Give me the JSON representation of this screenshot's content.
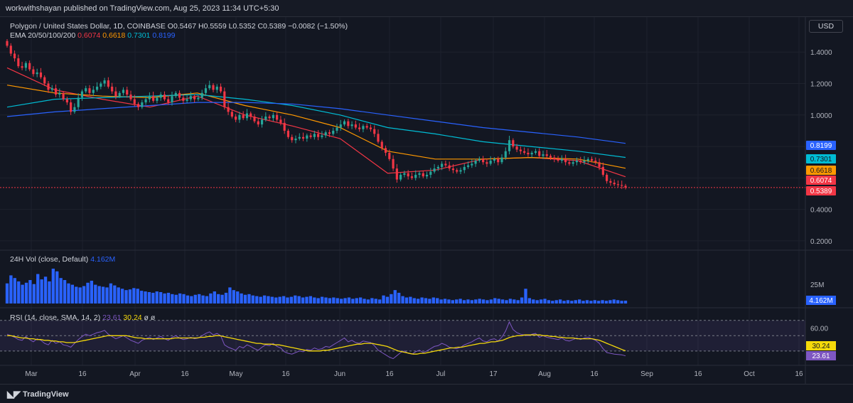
{
  "publish_line": "workwithshayan published on TradingView.com, Aug 25, 2023 11:34 UTC+5:30",
  "currency_button": "USD",
  "footer_logo_text": "TradingView",
  "legend": {
    "symbol": "Polygon / United States Dollar, 1D, COINBASE",
    "ohlc": "O0.5467 H0.5559 L0.5352 C0.5389 −0.0082 (−1.50%)",
    "ema_label": "EMA 20/50/100/200",
    "ema_values": [
      "0.6074",
      "0.6618",
      "0.7301",
      "0.8199"
    ]
  },
  "volume_legend": {
    "label": "24H Vol (close, Default)",
    "value": "4.162M"
  },
  "rsi_legend": {
    "label": "RSI (14, close, SMA, 14, 2)",
    "rsi": "23.61",
    "sma": "30.24",
    "extra": "ø ø"
  },
  "colors": {
    "background": "#131722",
    "grid": "#1e222d",
    "up": "#26a69a",
    "down": "#f23645",
    "ema20": "#f23645",
    "ema50": "#ff9800",
    "ema100": "#00bcd4",
    "ema200": "#2962ff",
    "volume": "#2962ff",
    "rsi": "#7e57c2",
    "rsi_sma": "#f5d90a"
  },
  "chart_data": {
    "type": "candlestick",
    "price_axis": {
      "ylim": [
        0.15,
        1.55
      ],
      "ticks": [
        "1.4000",
        "1.2000",
        "1.0000",
        "0.4000",
        "0.2000"
      ]
    },
    "time_axis": {
      "ticks": [
        "Mar",
        "16",
        "Apr",
        "16",
        "May",
        "16",
        "Jun",
        "16",
        "Jul",
        "17",
        "Aug",
        "16",
        "Sep",
        "16",
        "Oct",
        "16"
      ]
    },
    "price_labels": [
      {
        "value": 0.8199,
        "text": "0.8199",
        "color": "#2962ff"
      },
      {
        "value": 0.7301,
        "text": "0.7301",
        "color": "#00bcd4"
      },
      {
        "value": 0.6618,
        "text": "0.6618",
        "color": "#ff9800"
      },
      {
        "value": 0.6074,
        "text": "0.6074",
        "color": "#f23645"
      },
      {
        "value": 0.5389,
        "text": "0.5389",
        "color": "#f23645"
      }
    ],
    "last_close": 0.5389,
    "closes": [
      1.44,
      1.39,
      1.36,
      1.31,
      1.3,
      1.33,
      1.29,
      1.26,
      1.27,
      1.24,
      1.2,
      1.16,
      1.17,
      1.13,
      1.14,
      1.1,
      1.08,
      1.02,
      1.05,
      1.11,
      1.15,
      1.17,
      1.14,
      1.16,
      1.18,
      1.2,
      1.22,
      1.18,
      1.15,
      1.12,
      1.14,
      1.16,
      1.13,
      1.1,
      1.07,
      1.05,
      1.08,
      1.1,
      1.12,
      1.09,
      1.11,
      1.13,
      1.1,
      1.08,
      1.12,
      1.14,
      1.11,
      1.09,
      1.1,
      1.12,
      1.1,
      1.11,
      1.14,
      1.17,
      1.19,
      1.16,
      1.18,
      1.15,
      1.05,
      1.02,
      0.99,
      0.97,
      1.0,
      0.98,
      1.01,
      0.99,
      0.96,
      0.94,
      0.97,
      0.99,
      0.98,
      1.0,
      0.97,
      0.95,
      0.9,
      0.86,
      0.84,
      0.85,
      0.86,
      0.85,
      0.87,
      0.86,
      0.88,
      0.86,
      0.87,
      0.89,
      0.88,
      0.9,
      0.92,
      0.94,
      0.96,
      0.93,
      0.94,
      0.92,
      0.91,
      0.93,
      0.92,
      0.91,
      0.88,
      0.83,
      0.79,
      0.76,
      0.72,
      0.66,
      0.59,
      0.62,
      0.63,
      0.61,
      0.6,
      0.62,
      0.63,
      0.61,
      0.62,
      0.64,
      0.66,
      0.67,
      0.69,
      0.68,
      0.66,
      0.65,
      0.64,
      0.65,
      0.67,
      0.68,
      0.69,
      0.71,
      0.72,
      0.7,
      0.69,
      0.71,
      0.72,
      0.7,
      0.73,
      0.77,
      0.84,
      0.8,
      0.78,
      0.77,
      0.76,
      0.75,
      0.76,
      0.77,
      0.74,
      0.75,
      0.74,
      0.73,
      0.72,
      0.71,
      0.72,
      0.7,
      0.69,
      0.7,
      0.71,
      0.7,
      0.71,
      0.72,
      0.71,
      0.7,
      0.67,
      0.62,
      0.58,
      0.57,
      0.56,
      0.555,
      0.55,
      0.5389
    ],
    "ema": {
      "ema20": [
        1.3,
        1.16,
        1.1,
        1.05,
        1.12,
        1.0,
        0.93,
        0.85,
        0.63,
        0.65,
        0.72,
        0.73,
        0.71,
        0.6074
      ],
      "ema50": [
        1.19,
        1.14,
        1.12,
        1.11,
        1.14,
        1.06,
        1.0,
        0.92,
        0.77,
        0.72,
        0.72,
        0.73,
        0.72,
        0.6618
      ],
      "ema100": [
        1.05,
        1.1,
        1.11,
        1.12,
        1.13,
        1.1,
        1.06,
        1.0,
        0.92,
        0.88,
        0.83,
        0.8,
        0.77,
        0.7301
      ],
      "ema200": [
        0.99,
        1.02,
        1.04,
        1.06,
        1.08,
        1.08,
        1.07,
        1.04,
        1.0,
        0.96,
        0.92,
        0.89,
        0.86,
        0.8199
      ]
    },
    "volume": {
      "ticks": [
        "25M"
      ],
      "last": "4.162M",
      "values": [
        30,
        42,
        38,
        33,
        28,
        31,
        35,
        29,
        44,
        36,
        40,
        33,
        52,
        48,
        38,
        35,
        30,
        28,
        25,
        24,
        26,
        31,
        34,
        28,
        26,
        25,
        24,
        30,
        27,
        24,
        22,
        20,
        21,
        23,
        22,
        19,
        18,
        17,
        16,
        18,
        17,
        15,
        16,
        14,
        13,
        15,
        14,
        12,
        11,
        13,
        14,
        12,
        11,
        15,
        18,
        14,
        13,
        16,
        24,
        20,
        18,
        15,
        13,
        14,
        12,
        11,
        10,
        12,
        11,
        10,
        9,
        10,
        11,
        9,
        10,
        12,
        11,
        9,
        10,
        11,
        9,
        8,
        10,
        9,
        8,
        9,
        8,
        7,
        8,
        9,
        7,
        8,
        9,
        7,
        6,
        8,
        7,
        6,
        12,
        10,
        14,
        20,
        16,
        11,
        9,
        10,
        8,
        7,
        9,
        8,
        7,
        9,
        8,
        6,
        7,
        6,
        5,
        6,
        7,
        5,
        6,
        5,
        6,
        7,
        6,
        5,
        6,
        8,
        7,
        6,
        5,
        7,
        6,
        5,
        9,
        22,
        8,
        6,
        5,
        6,
        7,
        5,
        4,
        5,
        6,
        4,
        5,
        4,
        5,
        6,
        4,
        5,
        4,
        5,
        4,
        5,
        4,
        5,
        6,
        5,
        4,
        4.162
      ]
    },
    "rsi": {
      "ticks": [
        "60.00"
      ],
      "last": "23.61",
      "sma_last": "30.24",
      "bands": [
        30,
        50,
        70
      ],
      "values": [
        52,
        50,
        48,
        45,
        44,
        49,
        45,
        42,
        46,
        44,
        40,
        38,
        44,
        40,
        42,
        38,
        37,
        35,
        40,
        45,
        49,
        52,
        50,
        52,
        54,
        55,
        57,
        52,
        49,
        46,
        48,
        50,
        47,
        44,
        42,
        40,
        44,
        46,
        48,
        45,
        47,
        49,
        46,
        44,
        48,
        50,
        47,
        45,
        46,
        48,
        46,
        47,
        50,
        53,
        55,
        51,
        53,
        50,
        38,
        35,
        33,
        31,
        36,
        34,
        38,
        36,
        33,
        31,
        35,
        38,
        37,
        40,
        36,
        34,
        29,
        27,
        26,
        28,
        30,
        29,
        32,
        31,
        34,
        32,
        33,
        36,
        35,
        38,
        41,
        44,
        47,
        42,
        44,
        41,
        40,
        43,
        42,
        41,
        37,
        31,
        28,
        25,
        22,
        20,
        24,
        28,
        30,
        27,
        26,
        29,
        31,
        28,
        30,
        33,
        36,
        37,
        40,
        38,
        35,
        34,
        33,
        35,
        38,
        40,
        42,
        45,
        47,
        43,
        42,
        45,
        46,
        43,
        48,
        56,
        68,
        58,
        54,
        52,
        51,
        50,
        52,
        53,
        48,
        50,
        48,
        47,
        46,
        45,
        47,
        44,
        43,
        45,
        47,
        45,
        47,
        48,
        46,
        44,
        40,
        33,
        28,
        27,
        26,
        25.5,
        25,
        23.61
      ],
      "sma": [
        50,
        50,
        49,
        48,
        47,
        47,
        46,
        46,
        45,
        45,
        44,
        44,
        43,
        43,
        42,
        42,
        41,
        41,
        41,
        42,
        43,
        44,
        45,
        46,
        47,
        48,
        49,
        50,
        50,
        50,
        50,
        50,
        50,
        49,
        48,
        47,
        47,
        46,
        46,
        46,
        46,
        46,
        46,
        46,
        46,
        47,
        47,
        47,
        47,
        47,
        47,
        47,
        48,
        48,
        49,
        49,
        50,
        50,
        49,
        48,
        47,
        46,
        45,
        44,
        43,
        42,
        41,
        40,
        40,
        39,
        39,
        39,
        38,
        38,
        37,
        36,
        35,
        34,
        33,
        32,
        31,
        30,
        30,
        30,
        30,
        31,
        31,
        32,
        33,
        34,
        35,
        36,
        37,
        38,
        39,
        39,
        40,
        40,
        40,
        39,
        38,
        37,
        36,
        34,
        32,
        30,
        29,
        28,
        27,
        26,
        26,
        27,
        27,
        28,
        29,
        30,
        31,
        32,
        33,
        34,
        34,
        35,
        35,
        36,
        37,
        38,
        39,
        40,
        40,
        41,
        42,
        42,
        43,
        44,
        46,
        48,
        49,
        50,
        50,
        51,
        51,
        51,
        51,
        51,
        50,
        50,
        49,
        49,
        48,
        48,
        47,
        47,
        47,
        46,
        46,
        46,
        46,
        46,
        45,
        44,
        42,
        40,
        38,
        36,
        34,
        32,
        30.24
      ]
    }
  }
}
